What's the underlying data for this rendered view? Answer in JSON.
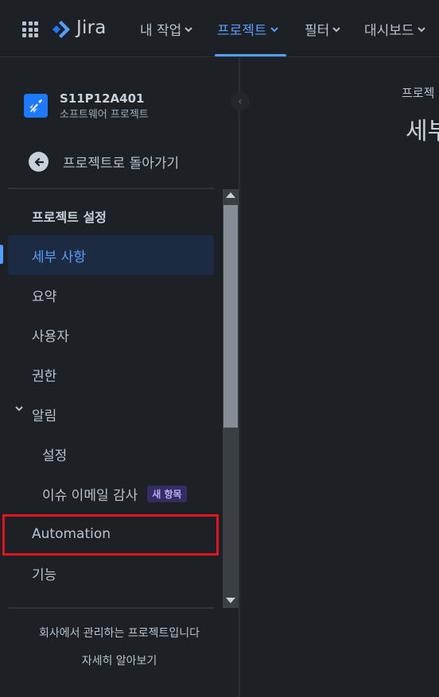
{
  "topnav": {
    "app_name": "Jira",
    "items": [
      {
        "label": "내 작업"
      },
      {
        "label": "프로젝트"
      },
      {
        "label": "필터"
      },
      {
        "label": "대시보드"
      }
    ],
    "active_item": "프로젝트",
    "accent_color": "#579dff"
  },
  "project": {
    "key": "S11P12A401",
    "type": "소프트웨어 프로젝트"
  },
  "sidebar": {
    "back_label": "프로젝트로 돌아가기",
    "section_title": "프로젝트 설정",
    "items": [
      {
        "label": "세부 사항",
        "selected": true
      },
      {
        "label": "요약"
      },
      {
        "label": "사용자"
      },
      {
        "label": "권한"
      },
      {
        "label": "알림",
        "expanded": true
      },
      {
        "label": "설정"
      },
      {
        "label": "이슈 이메일 감사",
        "badge": "새 항목"
      },
      {
        "label": "Automation",
        "highlighted": true
      },
      {
        "label": "기능"
      }
    ],
    "footer_text": "회사에서 관리하는 프로젝트입니다",
    "footer_link": "자세히 알아보기"
  },
  "main": {
    "breadcrumb": "프로젝",
    "title": "세부"
  },
  "icons": {
    "apps": "apps-grid-icon",
    "logo": "jira-logo-icon",
    "back": "arrow-left-circle-icon",
    "collapse": "chevron-left-icon"
  }
}
